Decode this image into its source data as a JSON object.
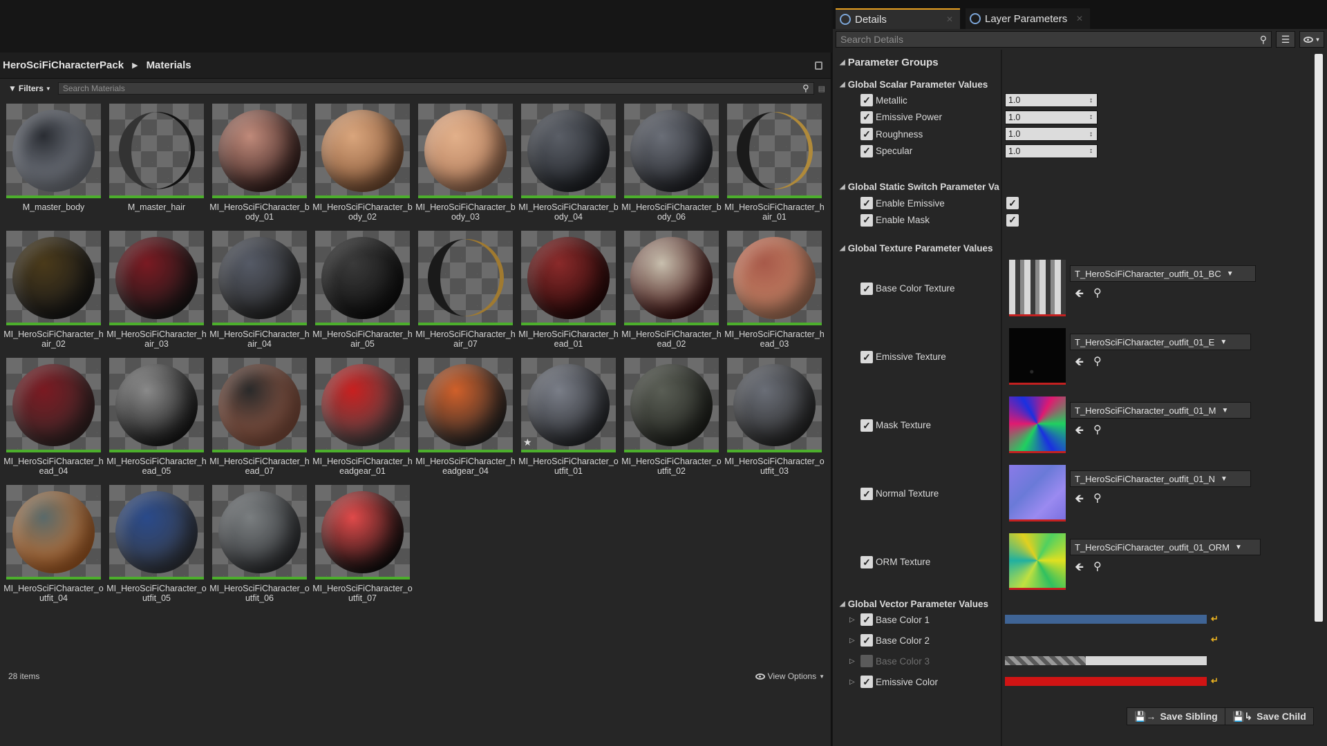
{
  "content_browser": {
    "breadcrumb": [
      "HeroSciFiCharacterPack",
      "Materials"
    ],
    "filters_label": "Filters",
    "search_placeholder": "Search Materials",
    "item_count": "28 items",
    "view_options_label": "View Options",
    "assets": [
      {
        "name": "M_master_body",
        "colors": [
          "#2a2d33",
          "#8a8f99"
        ],
        "style": "sphere"
      },
      {
        "name": "M_master_hair",
        "colors": [
          "#111111",
          "#333333"
        ],
        "style": "crescent"
      },
      {
        "name": "MI_HeroSciFiCharacter_body_01",
        "colors": [
          "#c08a7a",
          "#3a2220"
        ],
        "style": "sphere"
      },
      {
        "name": "MI_HeroSciFiCharacter_body_02",
        "colors": [
          "#d9a57c",
          "#8a5a3a"
        ],
        "style": "sphere"
      },
      {
        "name": "MI_HeroSciFiCharacter_body_03",
        "colors": [
          "#e2b08a",
          "#b07a5a"
        ],
        "style": "sphere"
      },
      {
        "name": "MI_HeroSciFiCharacter_body_04",
        "colors": [
          "#5a5e66",
          "#22252a"
        ],
        "style": "sphere"
      },
      {
        "name": "MI_HeroSciFiCharacter_body_06",
        "colors": [
          "#6a6e77",
          "#26282d"
        ],
        "style": "sphere"
      },
      {
        "name": "MI_HeroSciFiCharacter_hair_01",
        "colors": [
          "#b08a3a",
          "#1a1a1a"
        ],
        "style": "crescent"
      },
      {
        "name": "MI_HeroSciFiCharacter_hair_02",
        "colors": [
          "#4a3a1a",
          "#1a1a1a"
        ],
        "style": "sphere"
      },
      {
        "name": "MI_HeroSciFiCharacter_hair_03",
        "colors": [
          "#7a1a22",
          "#1a1a1a"
        ],
        "style": "sphere"
      },
      {
        "name": "MI_HeroSciFiCharacter_hair_04",
        "colors": [
          "#555a66",
          "#2a2a2a"
        ],
        "style": "sphere"
      },
      {
        "name": "MI_HeroSciFiCharacter_hair_05",
        "colors": [
          "#3a3a3a",
          "#101010"
        ],
        "style": "sphere"
      },
      {
        "name": "MI_HeroSciFiCharacter_hair_07",
        "colors": [
          "#a07a30",
          "#1a1a1a"
        ],
        "style": "crescent"
      },
      {
        "name": "MI_HeroSciFiCharacter_head_01",
        "colors": [
          "#8a2a2a",
          "#2a0a0a"
        ],
        "style": "sphere"
      },
      {
        "name": "MI_HeroSciFiCharacter_head_02",
        "colors": [
          "#c8bfae",
          "#3a0a0a"
        ],
        "style": "sphere"
      },
      {
        "name": "MI_HeroSciFiCharacter_head_03",
        "colors": [
          "#a85a4a",
          "#c88a6a"
        ],
        "style": "sphere"
      },
      {
        "name": "MI_HeroSciFiCharacter_head_04",
        "colors": [
          "#7a1a22",
          "#3a2a2a"
        ],
        "style": "sphere"
      },
      {
        "name": "MI_HeroSciFiCharacter_head_05",
        "colors": [
          "#8a8a8a",
          "#1a1a1a"
        ],
        "style": "sphere"
      },
      {
        "name": "MI_HeroSciFiCharacter_head_07",
        "colors": [
          "#2a2a2a",
          "#a0604a"
        ],
        "style": "sphere"
      },
      {
        "name": "MI_HeroSciFiCharacter_headgear_01",
        "colors": [
          "#c82020",
          "#4a4a4a"
        ],
        "style": "sphere"
      },
      {
        "name": "MI_HeroSciFiCharacter_headgear_04",
        "colors": [
          "#d0602a",
          "#2a2a2a"
        ],
        "style": "sphere"
      },
      {
        "name": "MI_HeroSciFiCharacter_outfit_01",
        "colors": [
          "#7a7e88",
          "#2a2c30"
        ],
        "style": "sphere",
        "favorite": true
      },
      {
        "name": "MI_HeroSciFiCharacter_outfit_02",
        "colors": [
          "#5a5e55",
          "#22241f"
        ],
        "style": "sphere"
      },
      {
        "name": "MI_HeroSciFiCharacter_outfit_03",
        "colors": [
          "#6a6e77",
          "#2a2a2a"
        ],
        "style": "sphere"
      },
      {
        "name": "MI_HeroSciFiCharacter_outfit_04",
        "colors": [
          "#5a6a6a",
          "#d0702a"
        ],
        "style": "sphere"
      },
      {
        "name": "MI_HeroSciFiCharacter_outfit_05",
        "colors": [
          "#2a4a8a",
          "#3a3e46"
        ],
        "style": "sphere"
      },
      {
        "name": "MI_HeroSciFiCharacter_outfit_06",
        "colors": [
          "#7a7e80",
          "#333538"
        ],
        "style": "sphere"
      },
      {
        "name": "MI_HeroSciFiCharacter_outfit_07",
        "colors": [
          "#e04a4a",
          "#111111"
        ],
        "style": "sphere"
      }
    ]
  },
  "details": {
    "tabs": [
      "Details",
      "Layer Parameters"
    ],
    "search_placeholder": "Search Details",
    "parameter_groups_title": "Parameter Groups",
    "scalar_group_title": "Global Scalar Parameter Values",
    "scalars": [
      {
        "label": "Metallic",
        "value": "1.0"
      },
      {
        "label": "Emissive Power",
        "value": "1.0"
      },
      {
        "label": "Roughness",
        "value": "1.0"
      },
      {
        "label": "Specular",
        "value": "1.0"
      }
    ],
    "switch_group_title": "Global Static Switch Parameter Va",
    "switches": [
      {
        "label": "Enable Emissive",
        "value": true
      },
      {
        "label": "Enable Mask",
        "value": true
      }
    ],
    "texture_group_title": "Global Texture Parameter Values",
    "textures": [
      {
        "label": "Base Color Texture",
        "asset": "T_HeroSciFiCharacter_outfit_01_BC",
        "preview": "base-color"
      },
      {
        "label": "Emissive Texture",
        "asset": "T_HeroSciFiCharacter_outfit_01_E",
        "preview": "emissive"
      },
      {
        "label": "Mask Texture",
        "asset": "T_HeroSciFiCharacter_outfit_01_M",
        "preview": "mask"
      },
      {
        "label": "Normal Texture",
        "asset": "T_HeroSciFiCharacter_outfit_01_N",
        "preview": "normal"
      },
      {
        "label": "ORM Texture",
        "asset": "T_HeroSciFiCharacter_outfit_01_ORM",
        "preview": "orm"
      }
    ],
    "vector_group_title": "Global Vector Parameter Values",
    "vectors": [
      {
        "label": "Base Color 1",
        "enabled": true,
        "color": "#3f6495"
      },
      {
        "label": "Base Color 2",
        "enabled": true,
        "color": "transparent"
      },
      {
        "label": "Base Color 3",
        "enabled": false,
        "color": "#d8d8d8"
      },
      {
        "label": "Emissive Color",
        "enabled": true,
        "color": "#d01414"
      }
    ],
    "save_sibling_label": "Save Sibling",
    "save_child_label": "Save Child"
  },
  "colors": {
    "accent": "#e8a020",
    "asset_bar": "#4caf2c",
    "texture_bar": "#c42020"
  }
}
